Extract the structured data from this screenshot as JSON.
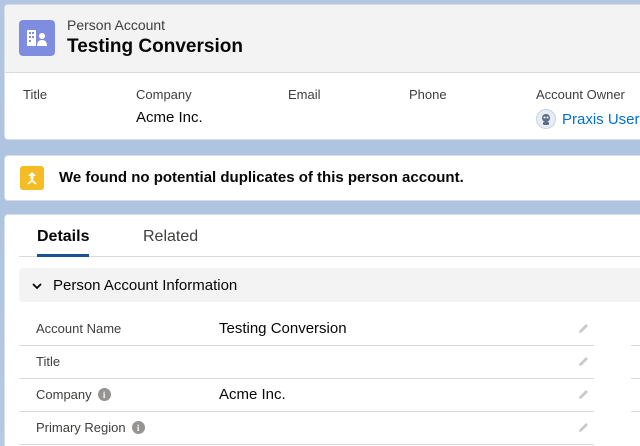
{
  "header": {
    "object_label": "Person Account",
    "title": "Testing Conversion",
    "entity_icon": "person-account-icon"
  },
  "highlights": [
    {
      "label": "Title",
      "value": ""
    },
    {
      "label": "Company",
      "value": "Acme Inc."
    },
    {
      "label": "Email",
      "value": ""
    },
    {
      "label": "Phone",
      "value": ""
    },
    {
      "label": "Account Owner",
      "value": "Praxis User"
    }
  ],
  "duplicates": {
    "icon": "duplicate-merge-icon",
    "message": "We found no potential duplicates of this person account."
  },
  "tabs": [
    {
      "label": "Details",
      "active": true
    },
    {
      "label": "Related",
      "active": false
    }
  ],
  "section": {
    "title": "Person Account Information"
  },
  "fields": [
    {
      "label": "Account Name",
      "value": "Testing Conversion",
      "info": false
    },
    {
      "label": "Title",
      "value": "",
      "info": false
    },
    {
      "label": "Company",
      "value": "Acme Inc.",
      "info": true
    },
    {
      "label": "Primary Region",
      "value": "",
      "info": true
    }
  ],
  "colors": {
    "entity_icon_bg": "#7f8de1",
    "duplicate_icon_bg": "#f4bc25",
    "link": "#0070d2",
    "active_tab": "#1b5297"
  }
}
